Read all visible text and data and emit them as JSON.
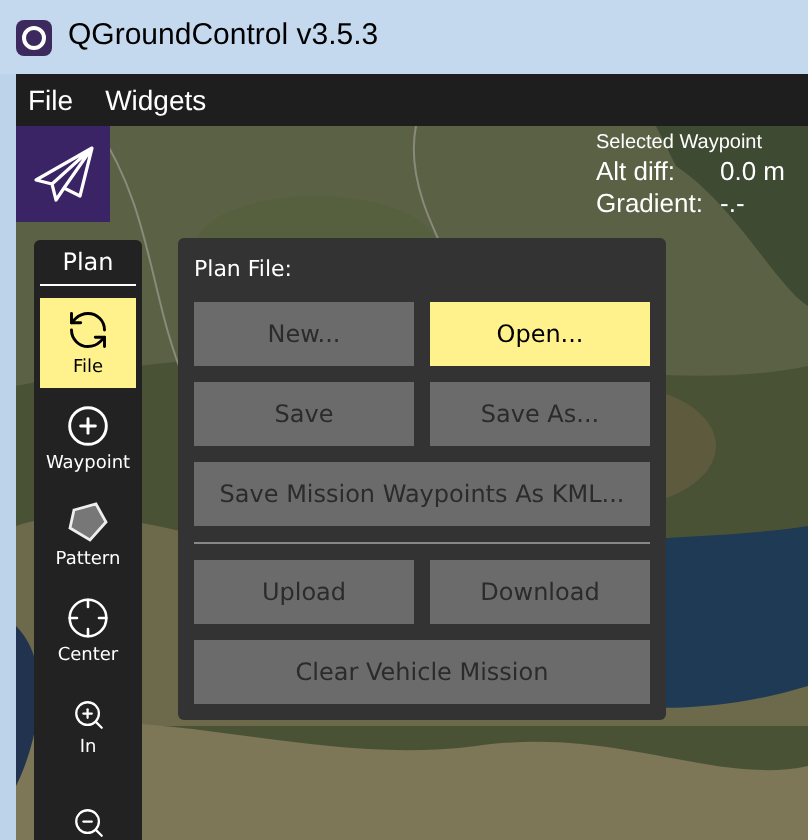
{
  "window": {
    "title": "QGroundControl v3.5.3"
  },
  "menu": [
    "File",
    "Widgets"
  ],
  "waypoint_info": {
    "title": "Selected Waypoint",
    "rows": [
      {
        "label": "Alt diff:",
        "value": "0.0 m"
      },
      {
        "label": "Gradient:",
        "value": "-.-"
      }
    ]
  },
  "toolbar": {
    "title": "Plan",
    "items": [
      {
        "kind": "file",
        "label": "File",
        "selected": true
      },
      {
        "kind": "waypoint",
        "label": "Waypoint",
        "selected": false
      },
      {
        "kind": "pattern",
        "label": "Pattern",
        "selected": false
      },
      {
        "kind": "center",
        "label": "Center",
        "selected": false
      },
      {
        "kind": "zoom_in",
        "label": "In",
        "selected": false
      },
      {
        "kind": "zoom_out",
        "selected": false
      }
    ]
  },
  "plan_file": {
    "title": "Plan File:",
    "groups": [
      [
        [
          {
            "label": "New...",
            "selected": false
          },
          {
            "label": "Open...",
            "selected": true
          }
        ],
        [
          {
            "label": "Save",
            "selected": false
          },
          {
            "label": "Save As...",
            "selected": false
          }
        ],
        [
          {
            "label": "Save Mission Waypoints As KML...",
            "selected": false
          }
        ]
      ],
      [
        [
          {
            "label": "Upload",
            "selected": false
          },
          {
            "label": "Download",
            "selected": false
          }
        ],
        [
          {
            "label": "Clear Vehicle Mission",
            "selected": false
          }
        ]
      ]
    ]
  }
}
